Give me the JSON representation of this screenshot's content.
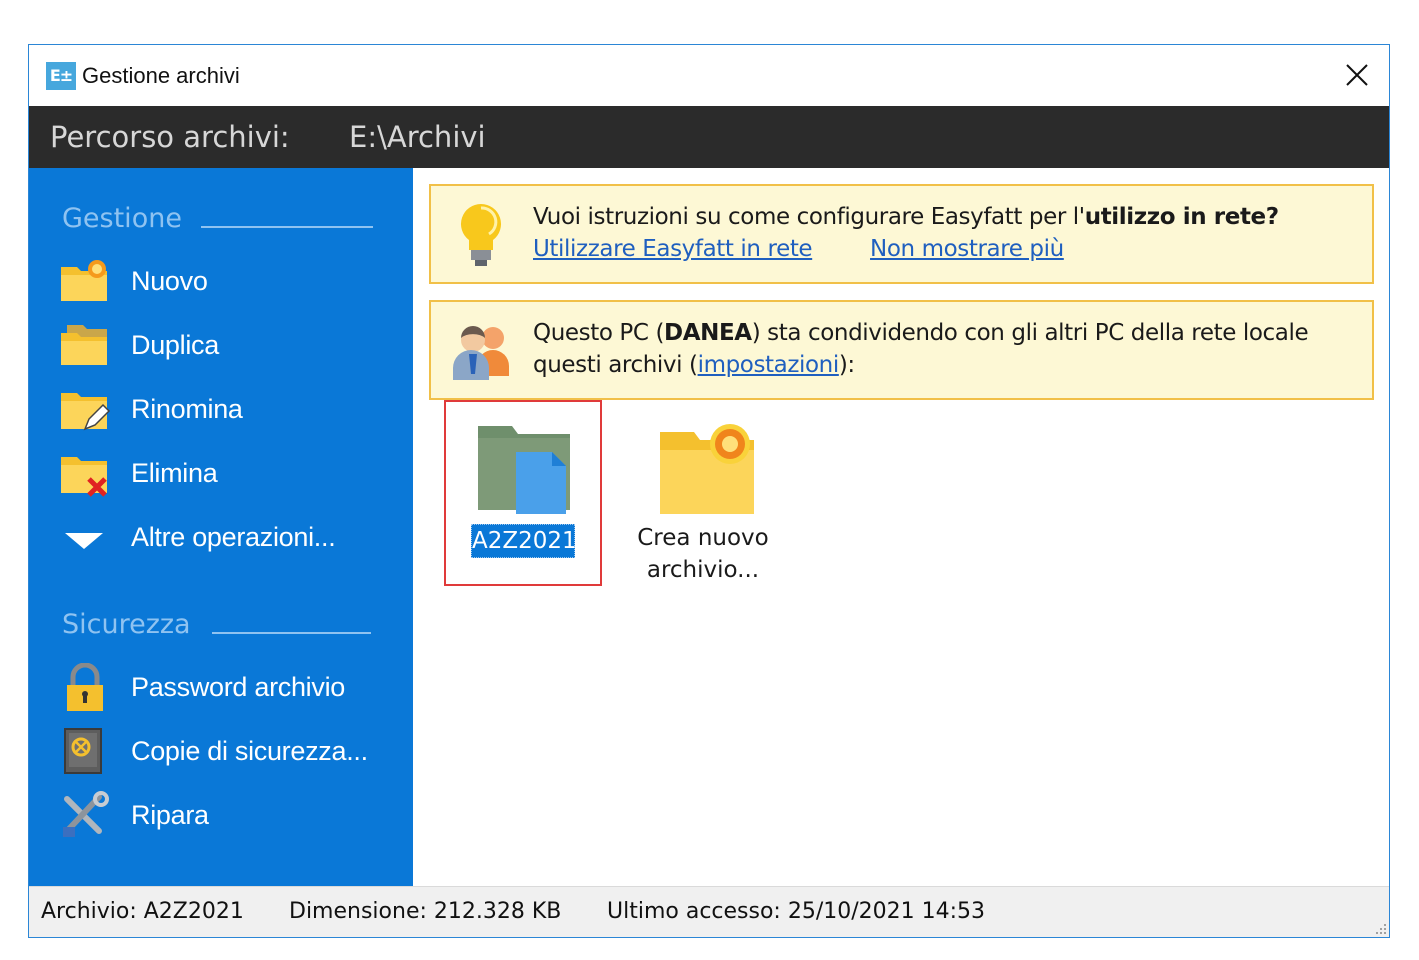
{
  "window": {
    "title": "Gestione archivi"
  },
  "path": {
    "label": "Percorso archivi:",
    "value": "E:\\Archivi"
  },
  "sidebar": {
    "gestione_title": "Gestione",
    "gestione_items": [
      {
        "label": "Nuovo",
        "icon": "new-folder-icon"
      },
      {
        "label": "Duplica",
        "icon": "duplicate-folder-icon"
      },
      {
        "label": "Rinomina",
        "icon": "rename-folder-icon"
      },
      {
        "label": "Elimina",
        "icon": "delete-folder-icon"
      },
      {
        "label": "Altre operazioni...",
        "icon": "chevron-down-icon"
      }
    ],
    "sicurezza_title": "Sicurezza",
    "sicurezza_items": [
      {
        "label": "Password archivio",
        "icon": "padlock-icon"
      },
      {
        "label": "Copie di sicurezza...",
        "icon": "safe-icon"
      },
      {
        "label": "Ripara",
        "icon": "tools-icon"
      }
    ]
  },
  "network_banner": {
    "text_before": "Vuoi istruzioni su come configurare Easyfatt per l'",
    "text_bold": "utilizzo in rete?",
    "link_1": "Utilizzare Easyfatt in rete",
    "link_2": "Non mostrare più"
  },
  "share_banner": {
    "text_before": "Questo PC (",
    "pc_name": "DANEA",
    "text_after": ") sta condividendo con gli altri PC della rete locale",
    "line2_before": "questi archivi (",
    "link": "impostazioni",
    "line2_after": "):"
  },
  "archives": [
    {
      "label": "A2Z2021",
      "selected": true,
      "icon": "archive-folder-icon"
    },
    {
      "label_line1": "Crea nuovo",
      "label_line2": "archivio...",
      "icon": "new-archive-folder-icon"
    }
  ],
  "status": {
    "archivio": "Archivio: A2Z2021",
    "dimensione": "Dimensione: 212.328 KB",
    "ultimo_accesso": "Ultimo accesso: 25/10/2021 14:53"
  },
  "colors": {
    "sidebar": "#0a78d7",
    "pathbar": "#2b2b2b",
    "banner_bg": "#fdf8d5",
    "banner_border": "#f1c048",
    "selection": "#0a78d7",
    "selection_border": "#e03a3a"
  }
}
